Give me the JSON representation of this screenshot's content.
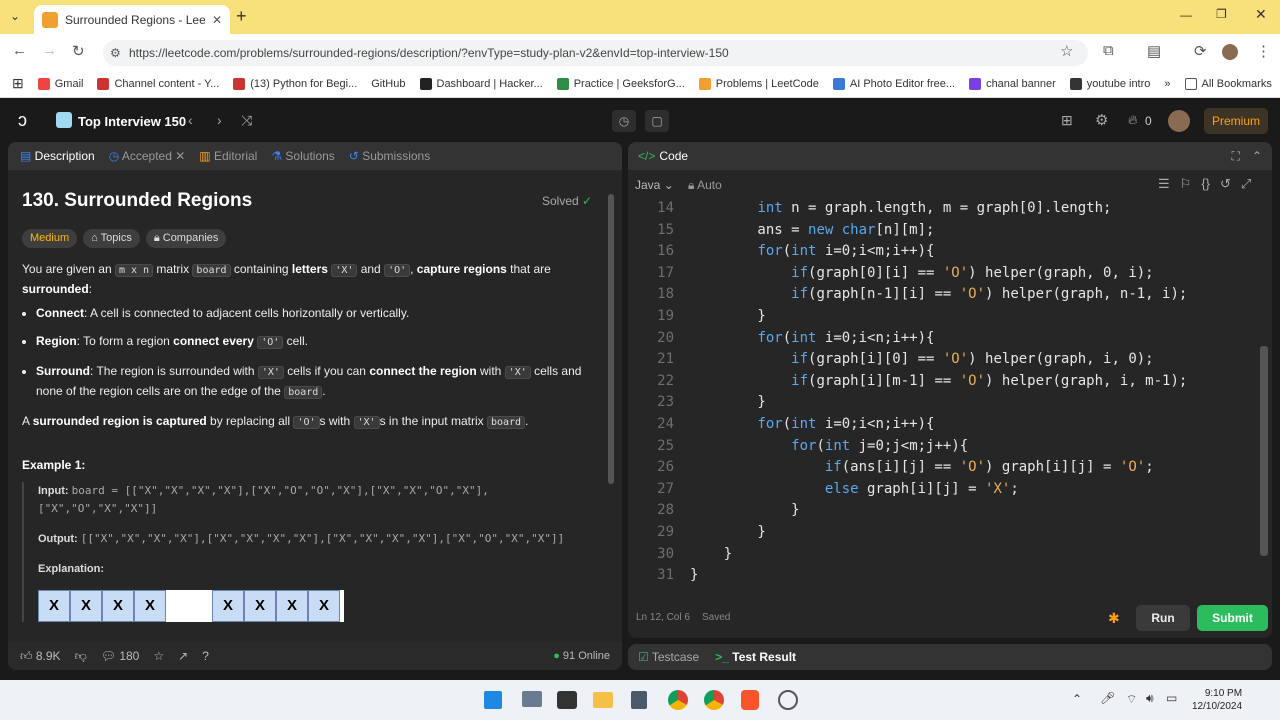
{
  "browser": {
    "tab_title": "Surrounded Regions - LeetCode",
    "url": "https://leetcode.com/problems/surrounded-regions/description/?envType=study-plan-v2&envId=top-interview-150",
    "bookmarks": [
      "Gmail",
      "Channel content - Y...",
      "(13) Python for Begi...",
      "GitHub",
      "Dashboard | Hacker...",
      "Practice | GeeksforG...",
      "Problems | LeetCode",
      "AI Photo Editor free...",
      "chanal banner",
      "youtube intro"
    ],
    "all_bookmarks": "All Bookmarks"
  },
  "nav": {
    "study_plan": "Top Interview 150",
    "streak": "0",
    "premium": "Premium"
  },
  "left_tabs": {
    "description": "Description",
    "accepted": "Accepted",
    "editorial": "Editorial",
    "solutions": "Solutions",
    "submissions": "Submissions"
  },
  "problem": {
    "title": "130. Surrounded Regions",
    "status": "Solved",
    "difficulty": "Medium",
    "topics": "Topics",
    "companies": "Companies",
    "p1": [
      "You are given an ",
      "m x n",
      " matrix ",
      "board",
      " containing ",
      "letters",
      " ",
      "'X'",
      " and ",
      "'O'",
      ", ",
      "capture regions",
      " that are ",
      "surrounded",
      ":"
    ],
    "b1": [
      "Connect",
      ": A cell is connected to adjacent cells horizontally or vertically."
    ],
    "b2": [
      "Region",
      ": To form a region ",
      "connect every",
      " ",
      "'O'",
      " cell."
    ],
    "b3": [
      "Surround",
      ": The region is surrounded with ",
      "'X'",
      " cells if you can ",
      "connect the region",
      " with ",
      "'X'",
      " cells and none of the region cells are on the edge of the ",
      "board",
      "."
    ],
    "p2": [
      "A ",
      "surrounded region is captured",
      " by replacing all ",
      "'O'",
      "s with ",
      "'X'",
      "s in the input matrix ",
      "board",
      "."
    ],
    "example": "Example 1:",
    "input_label": "Input:",
    "input": "board = [[\"X\",\"X\",\"X\",\"X\"],[\"X\",\"O\",\"O\",\"X\"],[\"X\",\"X\",\"O\",\"X\"],[\"X\",\"O\",\"X\",\"X\"]]",
    "output_label": "Output:",
    "output": "[[\"X\",\"X\",\"X\",\"X\"],[\"X\",\"X\",\"X\",\"X\"],[\"X\",\"X\",\"X\",\"X\"],[\"X\",\"O\",\"X\",\"X\"]]",
    "explanation": "Explanation:",
    "grid_row": [
      "X",
      "X",
      "X",
      "X",
      "X",
      "X",
      "X",
      "X"
    ]
  },
  "footer": {
    "likes": "8.9K",
    "comments": "180",
    "online": "91 Online"
  },
  "editor": {
    "header": "Code",
    "lang": "Java",
    "auto": "Auto",
    "status": "Ln 12, Col 6",
    "saved": "Saved",
    "run": "Run",
    "submit": "Submit",
    "lines": [
      {
        "n": "14",
        "t": "        int n = graph.length, m = graph[0].length;"
      },
      {
        "n": "15",
        "t": "        ans = new char[n][m];"
      },
      {
        "n": "16",
        "t": "        for(int i=0;i<m;i++){"
      },
      {
        "n": "17",
        "t": "            if(graph[0][i] == 'O') helper(graph, 0, i);"
      },
      {
        "n": "18",
        "t": "            if(graph[n-1][i] == 'O') helper(graph, n-1, i);"
      },
      {
        "n": "19",
        "t": "        }"
      },
      {
        "n": "20",
        "t": "        for(int i=0;i<n;i++){"
      },
      {
        "n": "21",
        "t": "            if(graph[i][0] == 'O') helper(graph, i, 0);"
      },
      {
        "n": "22",
        "t": "            if(graph[i][m-1] == 'O') helper(graph, i, m-1);"
      },
      {
        "n": "23",
        "t": "        }"
      },
      {
        "n": "24",
        "t": "        for(int i=0;i<n;i++){"
      },
      {
        "n": "25",
        "t": "            for(int j=0;j<m;j++){"
      },
      {
        "n": "26",
        "t": "                if(ans[i][j] == 'O') graph[i][j] = 'O';"
      },
      {
        "n": "27",
        "t": "                else graph[i][j] = 'X';"
      },
      {
        "n": "28",
        "t": "            }"
      },
      {
        "n": "29",
        "t": "        }"
      },
      {
        "n": "30",
        "t": "    }"
      },
      {
        "n": "31",
        "t": "}"
      }
    ]
  },
  "bottom": {
    "testcase": "Testcase",
    "test_result": "Test Result"
  },
  "taskbar": {
    "time": "9:10 PM",
    "date": "12/10/2024"
  }
}
